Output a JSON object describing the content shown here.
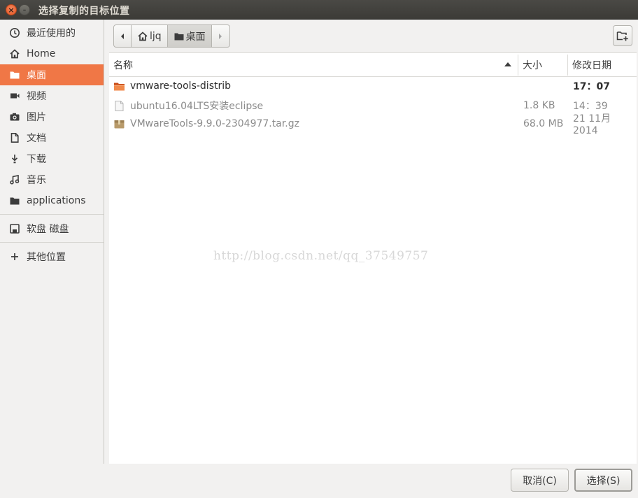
{
  "window": {
    "title": "选择复制的目标位置",
    "close_glyph": "×",
    "minimize_glyph": "–"
  },
  "sidebar": {
    "items": [
      {
        "label": "最近使用的",
        "icon": "clock-icon"
      },
      {
        "label": "Home",
        "icon": "home-icon"
      },
      {
        "label": "桌面",
        "icon": "folder-icon",
        "active": true
      },
      {
        "label": "视频",
        "icon": "video-icon"
      },
      {
        "label": "图片",
        "icon": "camera-icon"
      },
      {
        "label": "文档",
        "icon": "document-icon"
      },
      {
        "label": "下载",
        "icon": "download-icon"
      },
      {
        "label": "音乐",
        "icon": "music-icon"
      },
      {
        "label": "applications",
        "icon": "folder-icon"
      },
      {
        "label": "软盘 磁盘",
        "icon": "floppy-icon"
      },
      {
        "label": "其他位置",
        "icon": "plus-icon"
      }
    ]
  },
  "pathbar": {
    "segments": [
      {
        "label": "ljq",
        "icon": "home-icon"
      },
      {
        "label": "桌面",
        "icon": "folder-icon",
        "current": true
      }
    ]
  },
  "columns": {
    "name": "名称",
    "size": "大小",
    "modified": "修改日期",
    "sort": "name-descending"
  },
  "files": [
    {
      "name": "vmware-tools-distrib",
      "size": "",
      "modified": "17：07",
      "type": "folder",
      "emphasis": "bold"
    },
    {
      "name": "ubuntu16.04LTS安装eclipse",
      "size": "1.8 KB",
      "modified": "14：39",
      "type": "text-file",
      "emphasis": "dim"
    },
    {
      "name": "VMwareTools-9.9.0-2304977.tar.gz",
      "size": "68.0 MB",
      "modified": "21 11月 2014",
      "type": "archive",
      "emphasis": "dim"
    }
  ],
  "watermark": "http://blog.csdn.net/qq_37549757",
  "buttons": {
    "cancel": "取消(C)",
    "select": "选择(S)"
  },
  "colors": {
    "accent": "#f07746",
    "titlebar": "#3c3b37",
    "folder": "#e8612c"
  }
}
